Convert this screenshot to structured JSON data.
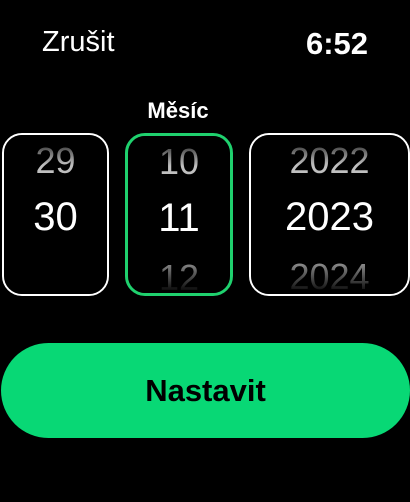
{
  "header": {
    "cancel_label": "Zrušit",
    "time": "6:52"
  },
  "active_column_label": "Měsíc",
  "pickers": {
    "day": {
      "prev": "29",
      "current": "30",
      "next": ""
    },
    "month": {
      "prev": "10",
      "current": "11",
      "next": "12"
    },
    "year": {
      "prev": "2022",
      "current": "2023",
      "next": "2024"
    }
  },
  "set_button_label": "Nastavit",
  "colors": {
    "accent": "#08d875",
    "active_border": "#1fd16e",
    "background": "#000000"
  }
}
